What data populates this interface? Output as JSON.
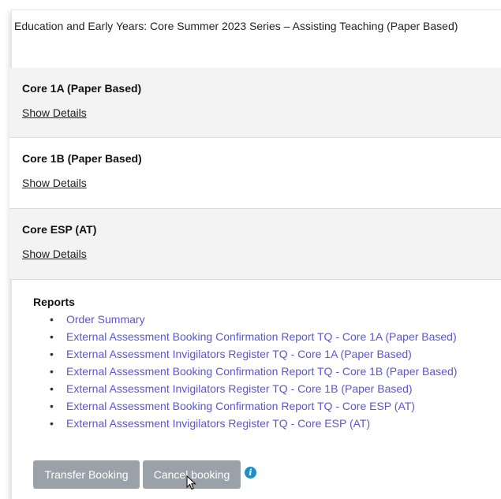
{
  "header": {
    "title": "Education and Early Years: Core Summer 2023 Series – Assisting Teaching (Paper Based)"
  },
  "sections": [
    {
      "title": "Core 1A (Paper Based)",
      "link": "Show Details"
    },
    {
      "title": "Core 1B (Paper Based)",
      "link": "Show Details"
    },
    {
      "title": "Core ESP (AT)",
      "link": "Show Details"
    }
  ],
  "reports": {
    "title": "Reports",
    "items": [
      "Order Summary",
      "External Assessment Booking Confirmation Report TQ - Core 1A (Paper Based)",
      "External Assessment Invigilators Register TQ - Core 1A (Paper Based)",
      "External Assessment Booking Confirmation Report TQ - Core 1B (Paper Based)",
      "External Assessment Invigilators Register TQ - Core 1B (Paper Based)",
      "External Assessment Booking Confirmation Report TQ - Core ESP (AT)",
      "External Assessment Invigilators Register TQ - Core ESP (AT)"
    ]
  },
  "actions": {
    "transfer_label": "Transfer Booking",
    "cancel_label": "Cancel booking",
    "info_icon": "info-icon",
    "info_glyph": "i"
  },
  "colors": {
    "link": "#5b55d4",
    "button_bg": "#9aa1a8",
    "section_bg": "#f3f3f3",
    "info": "#1f8fc5"
  }
}
